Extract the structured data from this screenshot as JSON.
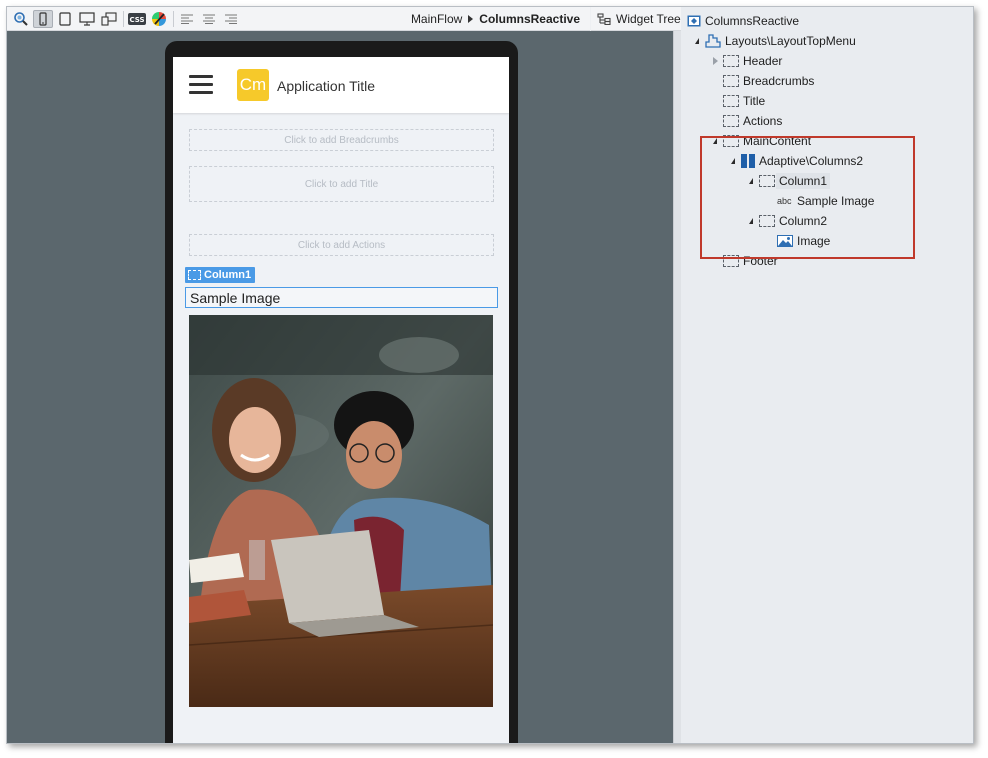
{
  "toolbar": {
    "icons": [
      "preview-icon",
      "phone-icon",
      "tablet-icon",
      "desktop-icon",
      "screens-icon",
      "css-icon",
      "theme-icon",
      "align-left-icon",
      "align-center-icon",
      "align-right-icon"
    ],
    "breadcrumb": {
      "flow": "MainFlow",
      "screen": "ColumnsReactive"
    }
  },
  "tab": {
    "label": "Widget Tree"
  },
  "app": {
    "logo_text": "Cm",
    "title": "Application Title",
    "placeholders": {
      "breadcrumbs": "Click to add Breadcrumbs",
      "title": "Click to add Title",
      "actions": "Click to add Actions"
    },
    "column_tag": "Column1",
    "column_text": "Sample Image"
  },
  "tree": {
    "root": "ColumnsReactive",
    "layout": "Layouts\\LayoutTopMenu",
    "header": "Header",
    "breadcrumbs": "Breadcrumbs",
    "title": "Title",
    "actions": "Actions",
    "main_content": "MainContent",
    "columns": "Adaptive\\Columns2",
    "column1": "Column1",
    "sample_image": "Sample Image",
    "column2": "Column2",
    "image": "Image",
    "footer": "Footer",
    "text_icon_label": "abc"
  },
  "colors": {
    "canvas": "#5b676d",
    "selection": "#4a9ae6",
    "highlight": "#c0392b",
    "logo": "#f6c92a"
  }
}
